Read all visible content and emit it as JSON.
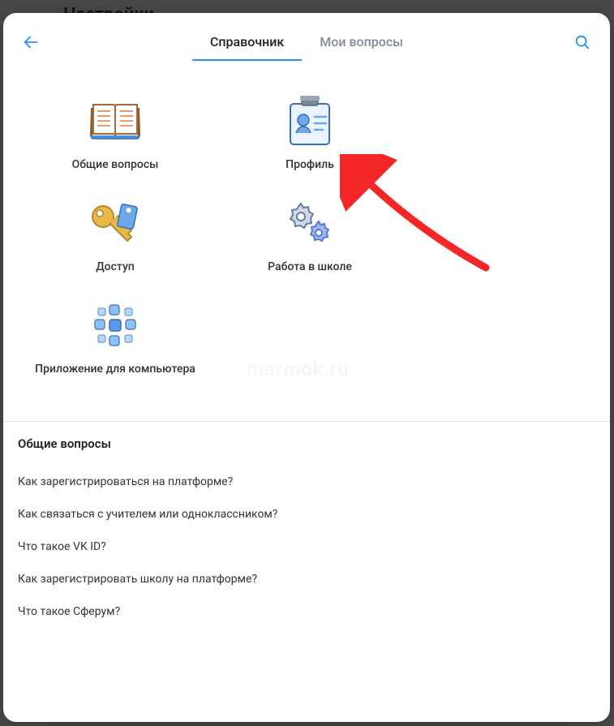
{
  "background": {
    "title": "Настройки"
  },
  "header": {
    "tabs": [
      {
        "label": "Справочник",
        "active": true
      },
      {
        "label": "Мои вопросы",
        "active": false
      }
    ]
  },
  "categories": [
    {
      "id": "general",
      "label": "Общие вопросы",
      "icon": "book-icon"
    },
    {
      "id": "profile",
      "label": "Профиль",
      "icon": "profile-card-icon"
    },
    {
      "id": "access",
      "label": "Доступ",
      "icon": "key-icon"
    },
    {
      "id": "school",
      "label": "Работа в школе",
      "icon": "gears-icon"
    },
    {
      "id": "desktop",
      "label": "Приложение для компьютера",
      "icon": "apps-icon"
    }
  ],
  "section": {
    "title": "Общие вопросы",
    "questions": [
      "Как зарегистрироваться на платформе?",
      "Как связаться с учителем или одноклассником?",
      "Что такое VK ID?",
      "Как зарегистрировать школу на платформе?",
      "Что такое Сферум?"
    ]
  },
  "watermark": "marmok.ru",
  "colors": {
    "accent": "#2a8fff",
    "arrow": "#f52626"
  }
}
